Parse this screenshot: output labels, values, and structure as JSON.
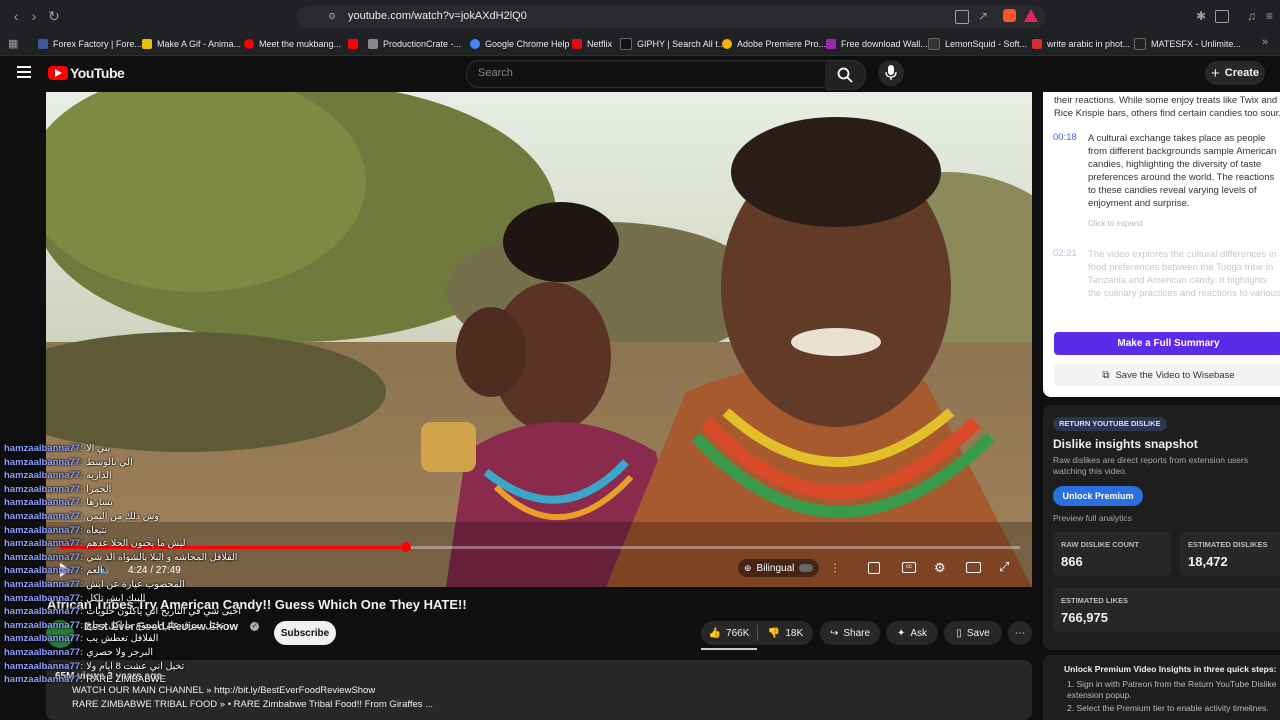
{
  "browser": {
    "url": "youtube.com/watch?v=jokAXdH2lQ0",
    "bookmarks": [
      {
        "label": "Forex Factory | Fore...",
        "color": "#3b5998"
      },
      {
        "label": "Make A Gif - Anima...",
        "color": "#e8c400"
      },
      {
        "label": "Meet the mukbang...",
        "color": "#ff0000"
      },
      {
        "label": "",
        "color": "#ff0000"
      },
      {
        "label": "ProductionCrate -...",
        "color": "#888888"
      },
      {
        "label": "Google Chrome Help",
        "color": "#4285f4"
      },
      {
        "label": "Netflix",
        "color": "#e50914"
      },
      {
        "label": "GIPHY | Search All t...",
        "color": "#111111"
      },
      {
        "label": "Adobe Premiere Pro...",
        "color": "#f4b400"
      },
      {
        "label": "Free download Wall...",
        "color": "#9c27b0"
      },
      {
        "label": "LemonSquid - Soft...",
        "color": "#333333"
      },
      {
        "label": "write arabic in phot...",
        "color": "#d32f2f"
      },
      {
        "label": "MATESFX - Unlimite...",
        "color": "#222222"
      }
    ]
  },
  "header": {
    "logo": "YouTube",
    "search_placeholder": "Search",
    "create_label": "Create"
  },
  "video": {
    "time": "4:24 / 27:49",
    "bilingual": "Bilingual",
    "title": "African Tribes Try American Candy!! Guess Which One They HATE!!",
    "channel": "Best Ever Food Review Show",
    "subscribe": "Subscribe",
    "likes": "766K",
    "dislikes": "18K",
    "share": "Share",
    "ask": "Ask",
    "save": "Save",
    "views": "65M views  3 years ago",
    "desc_line1": "WATCH OUR MAIN CHANNEL » http://bit.ly/BestEverFoodReviewShow",
    "desc_line2": "RARE ZIMBABWE TRIBAL FOOD »  • RARE Zimbabwe Tribal Food!! From Giraffes ...",
    "progress": 0.36
  },
  "summary_panel": {
    "intro": "their reactions. While some enjoy treats like Twix and Rice Krispie bars, others find certain candies too sour.",
    "items": [
      {
        "time": "00:18",
        "text": "A cultural exchange takes place as people from different backgrounds sample American candies, highlighting the diversity of taste preferences around the world. The reactions to these candies reveal varying levels of enjoyment and surprise."
      },
      {
        "time": "02:21",
        "text": "The video explores the cultural differences in food preferences between the Tooga tribe in Tanzania and American candy. It highlights the culinary practices and reactions to various sweets."
      }
    ],
    "expand": "Click to expand",
    "full_summary_button": "Make a Full Summary",
    "save_button": "Save the Video to Wisebase"
  },
  "dislike_panel": {
    "tag": "RETURN YOUTUBE DISLIKE",
    "heading": "Dislike insights snapshot",
    "desc": "Raw dislikes are direct reports from extension users watching this video.",
    "unlock": "Unlock Premium",
    "preview": "Preview full analytics",
    "raw_label": "RAW DISLIKE COUNT",
    "raw_value": "866",
    "est_dislike_label": "ESTIMATED DISLIKES",
    "est_dislike_value": "18,472",
    "est_likes_label": "ESTIMATED LIKES",
    "est_likes_value": "766,975"
  },
  "premium_panel": {
    "heading": "Unlock Premium Video Insights in three quick steps:",
    "step1": "1. Sign in with Patreon from the Return YouTube Dislike extension popup.",
    "step2": "2. Select the Premium tier to enable activity timelines."
  },
  "chat": {
    "user": "hamzaalbanna77:",
    "messages": [
      "يبي الا",
      "الي بالوسط",
      "الداريه",
      "الحمرا",
      "يسارها",
      "وش ذلك من اليمن",
      "نتيعاه",
      "ليش ما يحبون الحلا عدهم",
      "الفلافل المحاشه و البلا يالشواه الذ شي",
      "العم",
      "المحصوب عيارة عن ايش",
      "البيك ايش تاكل",
      "اخبى شي في التاريخ اني ياكلون حلويات",
      "تخيل يمرق علي اسبوع ما اكل دجاج",
      "الفلافل تعطش يب",
      "البرجر ولا حصري",
      "تخيل اني عشت 8 ايام ولا",
      "RARE ZIMBABWE"
    ]
  }
}
